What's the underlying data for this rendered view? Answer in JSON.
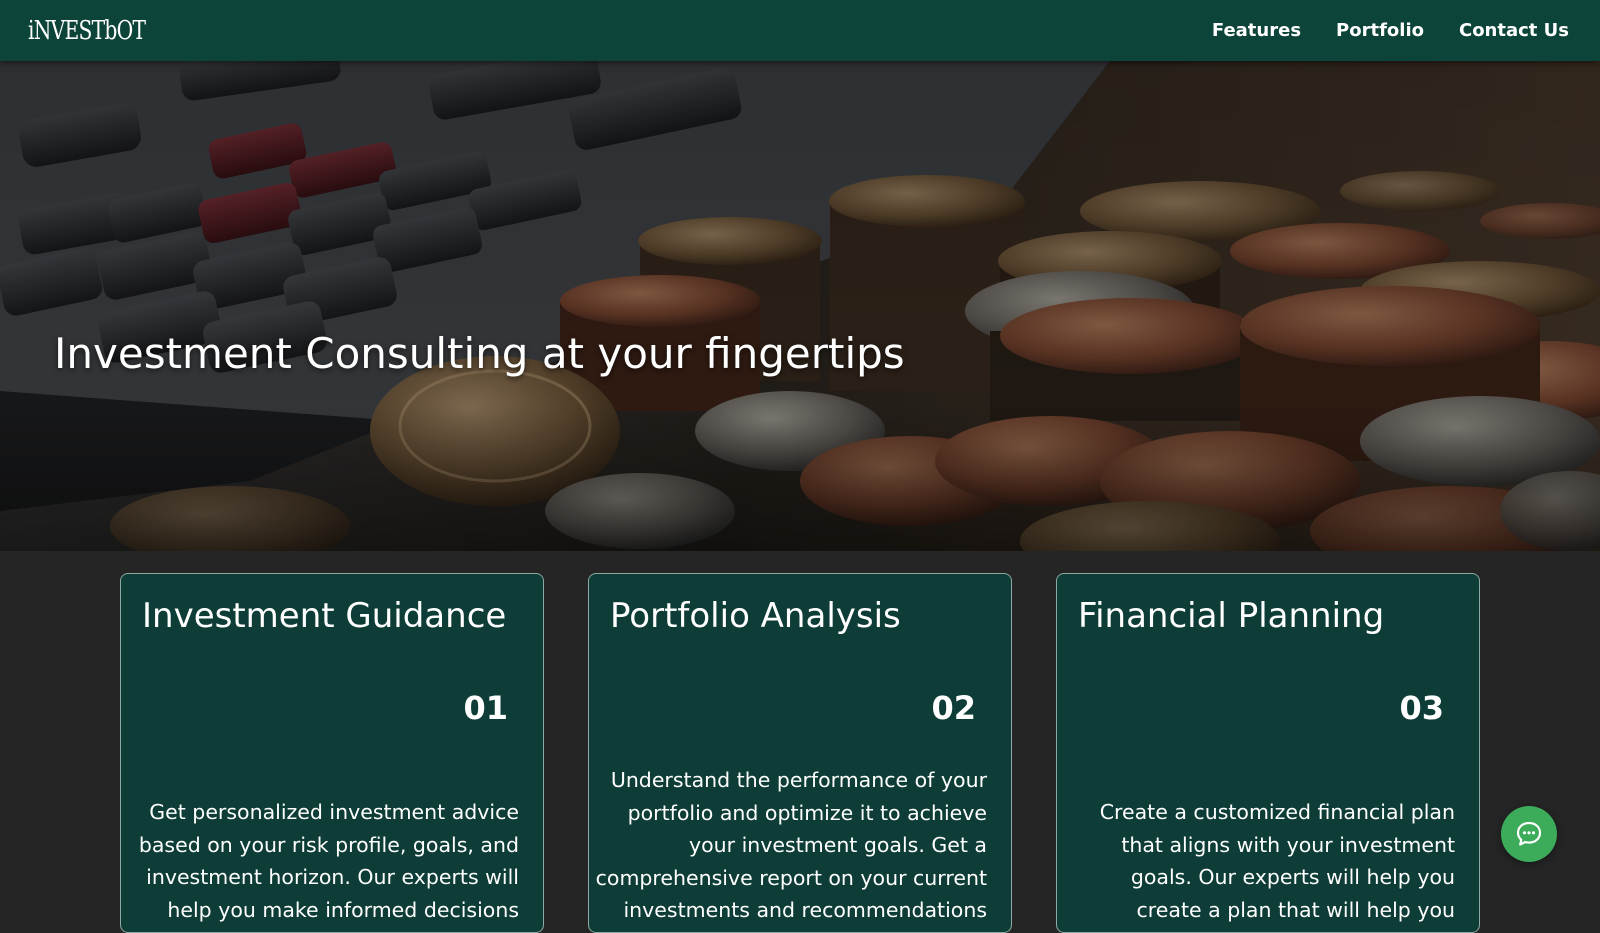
{
  "brand": {
    "logo_text": "iNVESTbOT"
  },
  "nav": {
    "items": [
      {
        "label": "Features"
      },
      {
        "label": "Portfolio"
      },
      {
        "label": "Contact Us"
      }
    ]
  },
  "hero": {
    "title": "Investment Consulting at your fingertips",
    "image": "calculator-and-coins-photo"
  },
  "cards": [
    {
      "title": "Investment Guidance",
      "number": "01",
      "text": "Get personalized investment advice based on your risk profile, goals, and investment horizon. Our experts will help you make informed decisions and"
    },
    {
      "title": "Portfolio Analysis",
      "number": "02",
      "text": "Understand the performance of your portfolio and optimize it to achieve your investment goals. Get a comprehensive report on your current investments and recommendations on how to improve"
    },
    {
      "title": "Financial Planning",
      "number": "03",
      "text": "Create a customized financial plan that aligns with your investment goals. Our experts will help you create a plan that will help you achieve your long-term"
    }
  ],
  "chat": {
    "icon": "chat-bubble-icon"
  },
  "colors": {
    "nav_bg": "#0d443a",
    "card_bg": "#0d3d36",
    "page_bg": "#252525",
    "chat_button": "#3cab5a"
  }
}
